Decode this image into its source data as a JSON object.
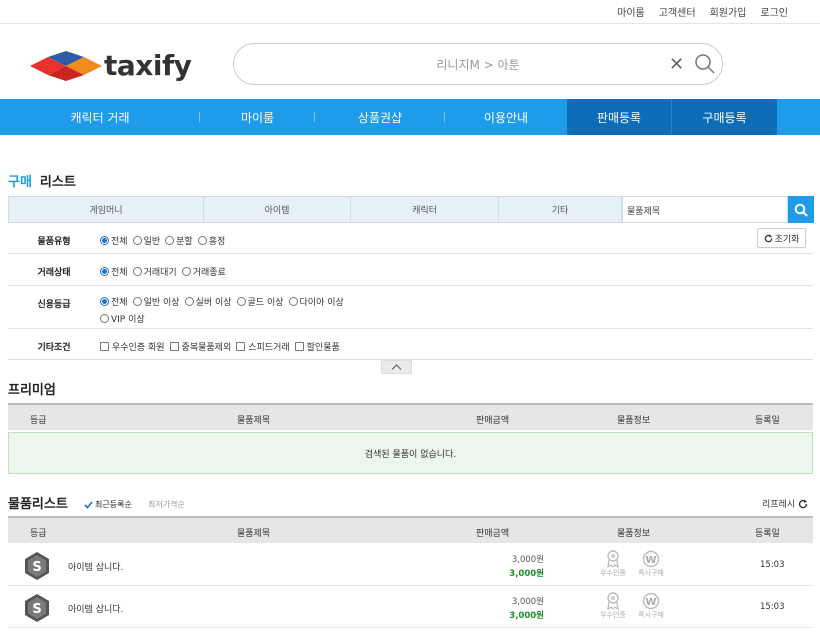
{
  "top_links": [
    "마이룸",
    "고객센터",
    "회원가입",
    "로그인"
  ],
  "brand": {
    "name": "taxify",
    "colors": {
      "red": "#e8322b",
      "orange": "#f28a1e",
      "blue": "#2e5ba8",
      "accent": "#1e9be9"
    }
  },
  "search": {
    "placeholder": "리니지M > 아툰"
  },
  "nav": [
    "캐릭터 거래",
    "마이룸",
    "상품권샵",
    "이용안내",
    "판매등록",
    "구매등록"
  ],
  "section": {
    "active": "구매",
    "other": "리스트"
  },
  "categories": [
    "게임머니",
    "아이템",
    "캐릭터",
    "기타"
  ],
  "category_search_placeholder": "물품제목",
  "filters": {
    "reset": "초기화",
    "type": {
      "label": "물품유형",
      "options": [
        "전체",
        "일반",
        "분할",
        "흥정"
      ],
      "selected": "전체"
    },
    "status": {
      "label": "거래상태",
      "options": [
        "전체",
        "거래대기",
        "거래종료"
      ],
      "selected": "전체"
    },
    "credit": {
      "label": "신용등급",
      "options": [
        "전체",
        "일반 이상",
        "실버 이상",
        "골드 이상",
        "다이아 이상",
        "VIP 이상"
      ],
      "selected": "전체"
    },
    "etc": {
      "label": "기타조건",
      "options": [
        "우수인증 회원",
        "중복물품제외",
        "스피드거래",
        "할인물품"
      ]
    }
  },
  "premium": {
    "title": "프리미엄",
    "columns": [
      "등급",
      "물품제목",
      "판매금액",
      "물품정보",
      "등록일"
    ],
    "empty_message": "검색된 물품이 없습니다."
  },
  "list": {
    "title": "물품리스트",
    "sort_active": "최근등록순",
    "sort_other": "최저가격순",
    "refresh": "리프레시",
    "columns": [
      "등급",
      "물품제목",
      "판매금액",
      "물품정보",
      "등록일"
    ],
    "info_labels": [
      "우수인증",
      "즉시구매"
    ],
    "rows": [
      {
        "grade": "S",
        "title": "아이템 삽니다.",
        "price_original": "3,000원",
        "price": "3,000원",
        "time": "15:03"
      },
      {
        "grade": "S",
        "title": "아이템 삽니다.",
        "price_original": "3,000원",
        "price": "3,000원",
        "time": "15:03"
      }
    ]
  }
}
